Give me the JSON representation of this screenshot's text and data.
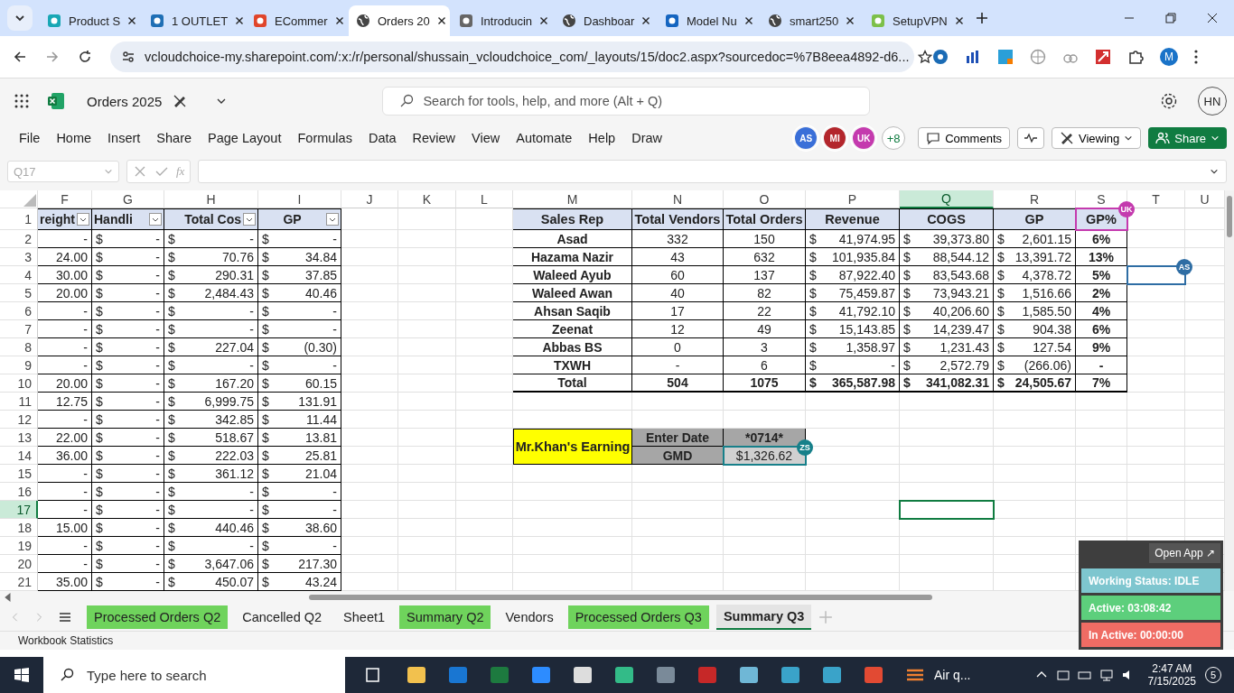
{
  "browser": {
    "tabs": [
      {
        "title": "Product S",
        "selected": false
      },
      {
        "title": "1 OUTLET",
        "selected": false
      },
      {
        "title": "ECommer",
        "selected": false
      },
      {
        "title": "Orders 20",
        "selected": true
      },
      {
        "title": "Introducin",
        "selected": false
      },
      {
        "title": "Dashboar",
        "selected": false
      },
      {
        "title": "Model Nu",
        "selected": false
      },
      {
        "title": "smart250",
        "selected": false
      },
      {
        "title": "SetupVPN",
        "selected": false
      }
    ],
    "url": "vcloudchoice-my.sharepoint.com/:x:/r/personal/shussain_vcloudchoice_com/_layouts/15/doc2.aspx?sourcedoc=%7B8eea4892-d6...",
    "profile": "M"
  },
  "excel": {
    "doc_title": "Orders 2025",
    "search_placeholder": "Search for tools, help, and more (Alt + Q)",
    "user_initials": "HN",
    "menu": [
      "File",
      "Home",
      "Insert",
      "Share",
      "Page Layout",
      "Formulas",
      "Data",
      "Review",
      "View",
      "Automate",
      "Help",
      "Draw"
    ],
    "collaborators": [
      {
        "initials": "AS",
        "color": "#3a6fd8"
      },
      {
        "initials": "MI",
        "color": "#b3262c"
      },
      {
        "initials": "UK",
        "color": "#c43aae"
      }
    ],
    "more_collaborators": "+8",
    "comments": "Comments",
    "mode": "Viewing",
    "share": "Share",
    "name_box": "Q17",
    "function_label": "fx"
  },
  "sheet": {
    "columns": [
      {
        "letter": "F",
        "selected": false
      },
      {
        "letter": "G",
        "selected": false
      },
      {
        "letter": "H",
        "selected": false
      },
      {
        "letter": "I",
        "selected": false
      },
      {
        "letter": "J",
        "selected": false
      },
      {
        "letter": "K",
        "selected": false
      },
      {
        "letter": "L",
        "selected": false
      },
      {
        "letter": "M",
        "selected": false
      },
      {
        "letter": "N",
        "selected": false
      },
      {
        "letter": "O",
        "selected": false
      },
      {
        "letter": "P",
        "selected": false
      },
      {
        "letter": "Q",
        "selected": true
      },
      {
        "letter": "R",
        "selected": false
      },
      {
        "letter": "S",
        "selected": false
      },
      {
        "letter": "T",
        "selected": false
      },
      {
        "letter": "U",
        "selected": false
      }
    ],
    "rows": [
      {
        "label": "1",
        "selected": false
      },
      {
        "label": "2",
        "selected": false
      },
      {
        "label": "3",
        "selected": false
      },
      {
        "label": "4",
        "selected": false
      },
      {
        "label": "5",
        "selected": false
      },
      {
        "label": "6",
        "selected": false
      },
      {
        "label": "7",
        "selected": false
      },
      {
        "label": "8",
        "selected": false
      },
      {
        "label": "9",
        "selected": false
      },
      {
        "label": "10",
        "selected": false
      },
      {
        "label": "11",
        "selected": false
      },
      {
        "label": "12",
        "selected": false
      },
      {
        "label": "13",
        "selected": false
      },
      {
        "label": "14",
        "selected": false
      },
      {
        "label": "15",
        "selected": false
      },
      {
        "label": "16",
        "selected": false
      },
      {
        "label": "17",
        "selected": true
      },
      {
        "label": "18",
        "selected": false
      },
      {
        "label": "19",
        "selected": false
      },
      {
        "label": "20",
        "selected": false
      },
      {
        "label": "21",
        "selected": false
      }
    ],
    "orders_table": {
      "headers": [
        "reight",
        "Handli",
        "Total Cos",
        "GP"
      ],
      "rows": [
        [
          "-",
          "$",
          "-",
          "$",
          "-",
          "$",
          "-"
        ],
        [
          "24.00",
          "$",
          "-",
          "$",
          "70.76",
          "$",
          "34.84"
        ],
        [
          "30.00",
          "$",
          "-",
          "$",
          "290.31",
          "$",
          "37.85"
        ],
        [
          "20.00",
          "$",
          "-",
          "$",
          "2,484.43",
          "$",
          "40.46"
        ],
        [
          "-",
          "$",
          "-",
          "$",
          "-",
          "$",
          "-"
        ],
        [
          "-",
          "$",
          "-",
          "$",
          "-",
          "$",
          "-"
        ],
        [
          "-",
          "$",
          "-",
          "$",
          "227.04",
          "$",
          "(0.30)"
        ],
        [
          "-",
          "$",
          "-",
          "$",
          "-",
          "$",
          "-"
        ],
        [
          "20.00",
          "$",
          "-",
          "$",
          "167.20",
          "$",
          "60.15"
        ],
        [
          "12.75",
          "$",
          "-",
          "$",
          "6,999.75",
          "$",
          "131.91"
        ],
        [
          "-",
          "$",
          "-",
          "$",
          "342.85",
          "$",
          "11.44"
        ],
        [
          "22.00",
          "$",
          "-",
          "$",
          "518.67",
          "$",
          "13.81"
        ],
        [
          "36.00",
          "$",
          "-",
          "$",
          "222.03",
          "$",
          "25.81"
        ],
        [
          "-",
          "$",
          "-",
          "$",
          "361.12",
          "$",
          "21.04"
        ],
        [
          "-",
          "$",
          "-",
          "$",
          "-",
          "$",
          "-"
        ],
        [
          "-",
          "$",
          "-",
          "$",
          "-",
          "$",
          "-"
        ],
        [
          "15.00",
          "$",
          "-",
          "$",
          "440.46",
          "$",
          "38.60"
        ],
        [
          "-",
          "$",
          "-",
          "$",
          "-",
          "$",
          "-"
        ],
        [
          "-",
          "$",
          "-",
          "$",
          "3,647.06",
          "$",
          "217.30"
        ],
        [
          "35.00",
          "$",
          "-",
          "$",
          "450.07",
          "$",
          "43.24"
        ]
      ]
    },
    "summary_table": {
      "headers": [
        "Sales Rep",
        "Total Vendors",
        "Total Orders",
        "Revenue",
        "COGS",
        "GP",
        "GP%"
      ],
      "rows": [
        {
          "kind": "rep",
          "cells": [
            "Asad",
            "332",
            "150",
            "$",
            "41,974.95",
            "$",
            "39,373.80",
            "$",
            "2,601.15",
            "6%"
          ]
        },
        {
          "kind": "rep",
          "cells": [
            "Hazama Nazir",
            "43",
            "632",
            "$",
            "101,935.84",
            "$",
            "88,544.12",
            "$",
            "13,391.72",
            "13%"
          ]
        },
        {
          "kind": "rep",
          "cells": [
            "Waleed Ayub",
            "60",
            "137",
            "$",
            "87,922.40",
            "$",
            "83,543.68",
            "$",
            "4,378.72",
            "5%"
          ]
        },
        {
          "kind": "rep",
          "cells": [
            "Waleed Awan",
            "40",
            "82",
            "$",
            "75,459.87",
            "$",
            "73,943.21",
            "$",
            "1,516.66",
            "2%"
          ]
        },
        {
          "kind": "rep",
          "cells": [
            "Ahsan Saqib",
            "17",
            "22",
            "$",
            "41,792.10",
            "$",
            "40,206.60",
            "$",
            "1,585.50",
            "4%"
          ]
        },
        {
          "kind": "rep",
          "cells": [
            "Zeenat",
            "12",
            "49",
            "$",
            "15,143.85",
            "$",
            "14,239.47",
            "$",
            "904.38",
            "6%"
          ]
        },
        {
          "kind": "rep",
          "cells": [
            "Abbas BS",
            "0",
            "3",
            "$",
            "1,358.97",
            "$",
            "1,231.43",
            "$",
            "127.54",
            "9%"
          ]
        },
        {
          "kind": "rep",
          "cells": [
            "TXWH",
            "-",
            "6",
            "$",
            "-",
            "$",
            "2,572.79",
            "$",
            "(266.06)",
            "-"
          ]
        },
        {
          "kind": "total",
          "cells": [
            "Total",
            "504",
            "1075",
            "$",
            "365,587.98",
            "$",
            "341,082.31",
            "$",
            "24,505.67",
            "7%"
          ]
        }
      ]
    },
    "earning": {
      "title": "Mr.Khan's Earning",
      "date_label": "Enter Date",
      "date_value": "*0714*",
      "amount_label": "GMD",
      "amount": "$1,326.62"
    },
    "presence_cursors": [
      {
        "initials": "UK",
        "color": "#c43aae"
      },
      {
        "initials": "AS",
        "color": "#2e6da4"
      },
      {
        "initials": "ZS",
        "color": "#17808a"
      }
    ]
  },
  "sheet_tabs": [
    {
      "label": "Processed Orders Q2",
      "color": "#6fd35c",
      "selected": false
    },
    {
      "label": "Cancelled Q2",
      "selected": false
    },
    {
      "label": "Sheet1",
      "selected": false
    },
    {
      "label": "Summary Q2",
      "color": "#6fd35c",
      "selected": false
    },
    {
      "label": "Vendors",
      "selected": false
    },
    {
      "label": "Processed Orders Q3",
      "color": "#6fd35c",
      "selected": false
    },
    {
      "label": "Summary Q3",
      "selected": true
    }
  ],
  "status_bar": {
    "text": "Workbook Statistics"
  },
  "tracker": {
    "open_app": "Open App ↗",
    "status": "Working Status: IDLE",
    "active": "Active: 03:08:42",
    "inactive": "In Active: 00:00:00"
  },
  "taskbar": {
    "search_placeholder": "Type here to search",
    "weather": "Air q...",
    "time": "2:47 AM",
    "date": "7/15/2025",
    "notifications": "5"
  }
}
